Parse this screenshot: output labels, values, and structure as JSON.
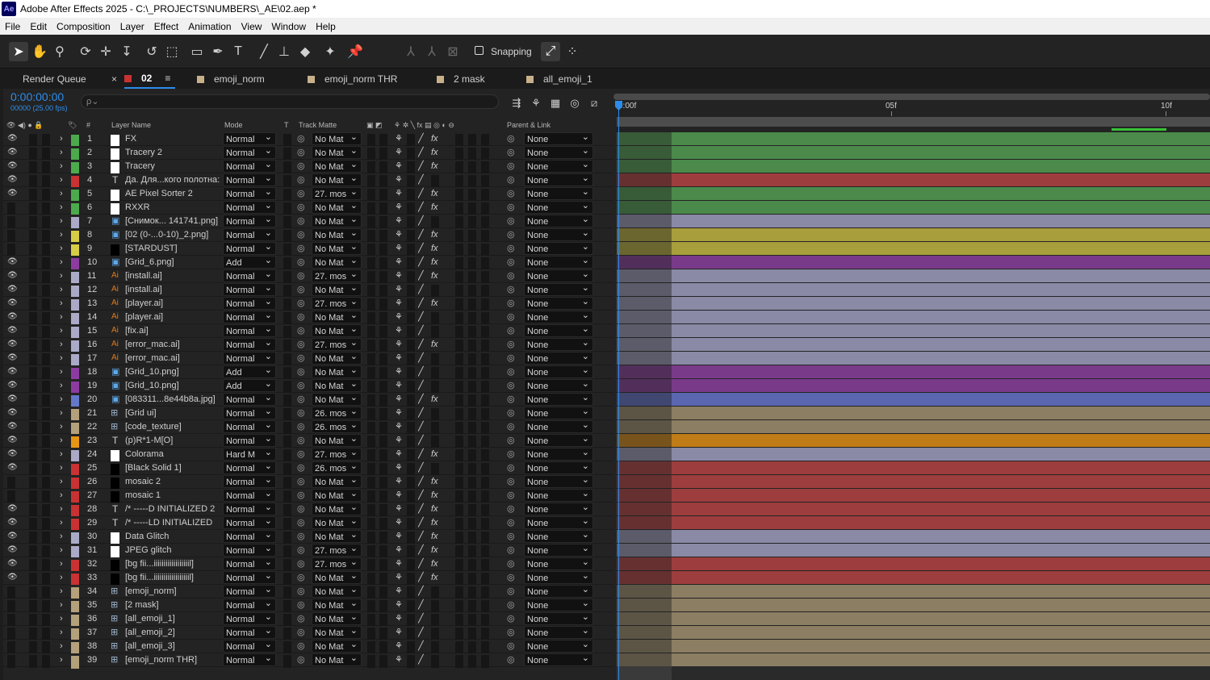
{
  "window": {
    "title": "Adobe After Effects 2025 - C:\\_PROJECTS\\NUMBERS\\_AE\\02.aep *",
    "app_icon": "Ae"
  },
  "menu": [
    "File",
    "Edit",
    "Composition",
    "Layer",
    "Effect",
    "Animation",
    "View",
    "Window",
    "Help"
  ],
  "toolbar": {
    "snapping_label": "Snapping"
  },
  "tabs": {
    "render_queue": "Render Queue",
    "active": "02",
    "others": [
      {
        "label": "emoji_norm",
        "color": "#c8b08a"
      },
      {
        "label": "emoji_norm THR",
        "color": "#c8b08a"
      },
      {
        "label": "2 mask",
        "color": "#c8b08a"
      },
      {
        "label": "all_emoji_1",
        "color": "#c8b08a"
      }
    ],
    "active_color": "#c83232"
  },
  "timecode": {
    "value": "0:00:00:00",
    "sub": "00000 (25.00 fps)"
  },
  "search": {
    "placeholder": "ρ⌄"
  },
  "columns": {
    "num": "#",
    "layer_name": "Layer Name",
    "mode": "Mode",
    "t": "T",
    "track_matte": "Track Matte",
    "parent": "Parent & Link"
  },
  "ruler": {
    "labels": [
      "0:00f",
      "05f",
      "10f"
    ]
  },
  "layers": [
    {
      "num": "1",
      "name": "FX",
      "color": "#4caa4c",
      "mode": "Normal",
      "matte": "No Mat",
      "parent": "None",
      "eye": true,
      "icon": "solid",
      "fx": true
    },
    {
      "num": "2",
      "name": "Tracery 2",
      "color": "#4caa4c",
      "mode": "Normal",
      "matte": "No Mat",
      "parent": "None",
      "eye": true,
      "icon": "solid",
      "fx": true
    },
    {
      "num": "3",
      "name": "Tracery",
      "color": "#4caa4c",
      "mode": "Normal",
      "matte": "No Mat",
      "parent": "None",
      "eye": true,
      "icon": "solid",
      "fx": true
    },
    {
      "num": "4",
      "name": "Да. Для...кого полотна:",
      "color": "#c83232",
      "mode": "Normal",
      "matte": "No Mat",
      "parent": "None",
      "eye": true,
      "icon": "text",
      "fx": false
    },
    {
      "num": "5",
      "name": "AE Pixel Sorter 2",
      "color": "#4caa4c",
      "mode": "Normal",
      "matte": "27. mos",
      "parent": "None",
      "eye": true,
      "icon": "solid",
      "fx": true
    },
    {
      "num": "6",
      "name": "RXXR",
      "color": "#4caa4c",
      "mode": "Normal",
      "matte": "No Mat",
      "parent": "None",
      "eye": false,
      "icon": "solid",
      "fx": true
    },
    {
      "num": "7",
      "name": "[Снимок... 141741.png]",
      "color": "#aaaac8",
      "mode": "Normal",
      "matte": "No Mat",
      "parent": "None",
      "eye": false,
      "icon": "file",
      "fx": false
    },
    {
      "num": "8",
      "name": "[02 (0-...0-10)_2.png]",
      "color": "#d6cc46",
      "mode": "Normal",
      "matte": "No Mat",
      "parent": "None",
      "eye": false,
      "icon": "file",
      "fx": true
    },
    {
      "num": "9",
      "name": "[STARDUST]",
      "color": "#d6cc46",
      "mode": "Normal",
      "matte": "No Mat",
      "parent": "None",
      "eye": false,
      "icon": "black",
      "fx": true
    },
    {
      "num": "10",
      "name": "[Grid_6.png]",
      "color": "#8c3ca0",
      "mode": "Add",
      "matte": "No Mat",
      "parent": "None",
      "eye": true,
      "icon": "file",
      "fx": true
    },
    {
      "num": "11",
      "name": "[install.ai]",
      "color": "#aaaac8",
      "mode": "Normal",
      "matte": "27. mos",
      "parent": "None",
      "eye": true,
      "icon": "ai",
      "fx": true
    },
    {
      "num": "12",
      "name": "[install.ai]",
      "color": "#aaaac8",
      "mode": "Normal",
      "matte": "No Mat",
      "parent": "None",
      "eye": true,
      "icon": "ai",
      "fx": false
    },
    {
      "num": "13",
      "name": "[player.ai]",
      "color": "#aaaac8",
      "mode": "Normal",
      "matte": "27. mos",
      "parent": "None",
      "eye": true,
      "icon": "ai",
      "fx": true
    },
    {
      "num": "14",
      "name": "[player.ai]",
      "color": "#aaaac8",
      "mode": "Normal",
      "matte": "No Mat",
      "parent": "None",
      "eye": true,
      "icon": "ai",
      "fx": false
    },
    {
      "num": "15",
      "name": "[fix.ai]",
      "color": "#aaaac8",
      "mode": "Normal",
      "matte": "No Mat",
      "parent": "None",
      "eye": true,
      "icon": "ai",
      "fx": false
    },
    {
      "num": "16",
      "name": "[error_mac.ai]",
      "color": "#aaaac8",
      "mode": "Normal",
      "matte": "27. mos",
      "parent": "None",
      "eye": true,
      "icon": "ai",
      "fx": true
    },
    {
      "num": "17",
      "name": "[error_mac.ai]",
      "color": "#aaaac8",
      "mode": "Normal",
      "matte": "No Mat",
      "parent": "None",
      "eye": true,
      "icon": "ai",
      "fx": false
    },
    {
      "num": "18",
      "name": "[Grid_10.png]",
      "color": "#8c3ca0",
      "mode": "Add",
      "matte": "No Mat",
      "parent": "None",
      "eye": true,
      "icon": "file",
      "fx": false
    },
    {
      "num": "19",
      "name": "[Grid_10.png]",
      "color": "#8c3ca0",
      "mode": "Add",
      "matte": "No Mat",
      "parent": "None",
      "eye": true,
      "icon": "file",
      "fx": false
    },
    {
      "num": "20",
      "name": "[083311...8e44b8a.jpg]",
      "color": "#6478c8",
      "mode": "Normal",
      "matte": "No Mat",
      "parent": "None",
      "eye": true,
      "icon": "file",
      "fx": true
    },
    {
      "num": "21",
      "name": "[Grid ui]",
      "color": "#b4a07a",
      "mode": "Normal",
      "matte": "26. mos",
      "parent": "None",
      "eye": true,
      "icon": "comp",
      "fx": false
    },
    {
      "num": "22",
      "name": "[code_texture]",
      "color": "#b4a07a",
      "mode": "Normal",
      "matte": "26. mos",
      "parent": "None",
      "eye": true,
      "icon": "comp",
      "fx": false
    },
    {
      "num": "23",
      "name": "(p)R*1-M[O]",
      "color": "#e69614",
      "mode": "Normal",
      "matte": "No Mat",
      "parent": "None",
      "eye": true,
      "icon": "text",
      "fx": false
    },
    {
      "num": "24",
      "name": "Colorama",
      "color": "#aaaac8",
      "mode": "Hard M",
      "matte": "27. mos",
      "parent": "None",
      "eye": true,
      "icon": "solid",
      "fx": true
    },
    {
      "num": "25",
      "name": "[Black Solid 1]",
      "color": "#c83232",
      "mode": "Normal",
      "matte": "26. mos",
      "parent": "None",
      "eye": true,
      "icon": "black",
      "fx": false
    },
    {
      "num": "26",
      "name": "mosaic 2",
      "color": "#c83232",
      "mode": "Normal",
      "matte": "No Mat",
      "parent": "None",
      "eye": false,
      "icon": "black",
      "fx": true
    },
    {
      "num": "27",
      "name": "mosaic 1",
      "color": "#c83232",
      "mode": "Normal",
      "matte": "No Mat",
      "parent": "None",
      "eye": false,
      "icon": "black",
      "fx": true
    },
    {
      "num": "28",
      "name": "/* -----D INITIALIZED 2",
      "color": "#c83232",
      "mode": "Normal",
      "matte": "No Mat",
      "parent": "None",
      "eye": true,
      "icon": "text",
      "fx": true
    },
    {
      "num": "29",
      "name": "/* -----LD INITIALIZED",
      "color": "#c83232",
      "mode": "Normal",
      "matte": "No Mat",
      "parent": "None",
      "eye": true,
      "icon": "text",
      "fx": true
    },
    {
      "num": "30",
      "name": "Data Glitch",
      "color": "#aaaac8",
      "mode": "Normal",
      "matte": "No Mat",
      "parent": "None",
      "eye": true,
      "icon": "solid",
      "fx": true
    },
    {
      "num": "31",
      "name": "JPEG glitch",
      "color": "#aaaac8",
      "mode": "Normal",
      "matte": "27. mos",
      "parent": "None",
      "eye": true,
      "icon": "solid",
      "fx": true
    },
    {
      "num": "32",
      "name": "[bg fii...iiiiiiiiiiiiiiiiiil]",
      "color": "#c83232",
      "mode": "Normal",
      "matte": "27. mos",
      "parent": "None",
      "eye": true,
      "icon": "black",
      "fx": true
    },
    {
      "num": "33",
      "name": "[bg fii...iiiiiiiiiiiiiiiiiil]",
      "color": "#c83232",
      "mode": "Normal",
      "matte": "No Mat",
      "parent": "None",
      "eye": true,
      "icon": "black",
      "fx": true
    },
    {
      "num": "34",
      "name": "[emoji_norm]",
      "color": "#b4a07a",
      "mode": "Normal",
      "matte": "No Mat",
      "parent": "None",
      "eye": false,
      "icon": "comp",
      "fx": false
    },
    {
      "num": "35",
      "name": "[2 mask]",
      "color": "#b4a07a",
      "mode": "Normal",
      "matte": "No Mat",
      "parent": "None",
      "eye": false,
      "icon": "comp",
      "fx": false
    },
    {
      "num": "36",
      "name": "[all_emoji_1]",
      "color": "#b4a07a",
      "mode": "Normal",
      "matte": "No Mat",
      "parent": "None",
      "eye": false,
      "icon": "comp",
      "fx": false
    },
    {
      "num": "37",
      "name": "[all_emoji_2]",
      "color": "#b4a07a",
      "mode": "Normal",
      "matte": "No Mat",
      "parent": "None",
      "eye": false,
      "icon": "comp",
      "fx": false
    },
    {
      "num": "38",
      "name": "[all_emoji_3]",
      "color": "#b4a07a",
      "mode": "Normal",
      "matte": "No Mat",
      "parent": "None",
      "eye": false,
      "icon": "comp",
      "fx": false
    },
    {
      "num": "39",
      "name": "[emoji_norm THR]",
      "color": "#b4a07a",
      "mode": "Normal",
      "matte": "No Mat",
      "parent": "None",
      "eye": false,
      "icon": "comp",
      "fx": false
    }
  ],
  "bar_colors": {
    "#4caa4c": "#4b8a4b",
    "#c83232": "#9e3d3d",
    "#aaaac8": "#8a8aa6",
    "#d6cc46": "#a89e3c",
    "#8c3ca0": "#7a3a8a",
    "#6478c8": "#5a66b0",
    "#b4a07a": "#8c7e62",
    "#e69614": "#c07c16"
  }
}
